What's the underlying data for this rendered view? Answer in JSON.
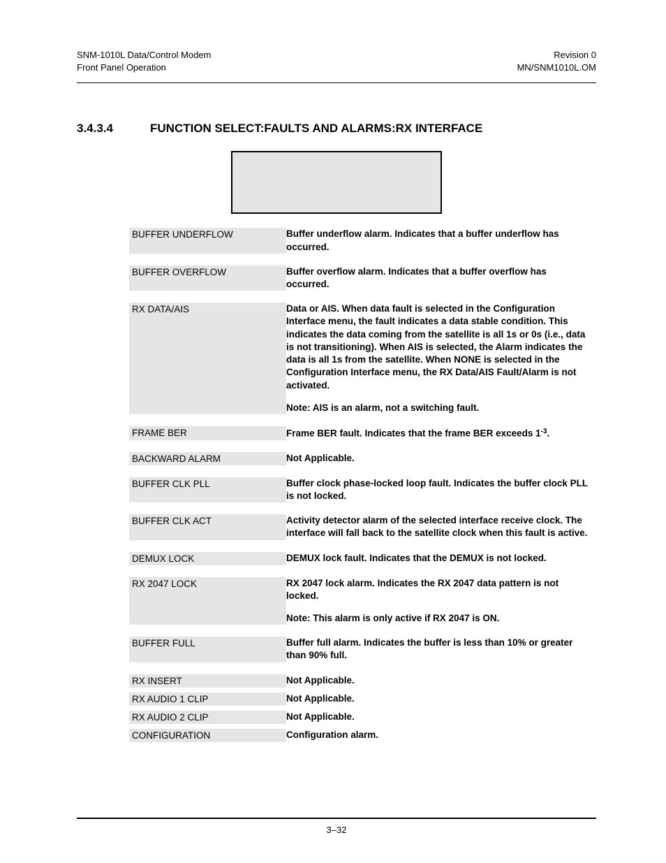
{
  "header": {
    "left_line1": "SNM-1010L Data/Control Modem",
    "left_line2": "Front Panel Operation",
    "right_line1": "Revision 0",
    "right_line2": "MN/SNM1010L.OM"
  },
  "section": {
    "number": "3.4.3.4",
    "title": "FUNCTION SELECT:FAULTS AND ALARMS:RX INTERFACE"
  },
  "rows": [
    {
      "label": "BUFFER UNDERFLOW",
      "desc": "Buffer underflow alarm. Indicates that a buffer underflow has occurred."
    },
    {
      "label": "BUFFER OVERFLOW",
      "desc": "Buffer overflow alarm. Indicates that a buffer overflow has occurred."
    },
    {
      "label": "RX DATA/AIS",
      "desc": "Data or AIS. When data fault is selected in the Configuration Interface menu, the fault indicates a data stable condition. This indicates the data coming from the satellite is all 1s or 0s (i.e., data is not transitioning). When AIS is selected, the Alarm indicates the data is all 1s from the satellite. When NONE is selected in the Configuration Interface menu, the RX Data/AIS Fault/Alarm is not activated.",
      "note": "Note: AIS is an alarm, not a switching fault."
    },
    {
      "label": "FRAME BER",
      "desc_pre": "Frame BER fault. Indicates that the frame BER exceeds 1",
      "desc_sup": "-3",
      "desc_post": "."
    },
    {
      "label": "BACKWARD ALARM",
      "desc": "Not Applicable."
    },
    {
      "label": "BUFFER CLK PLL",
      "desc": "Buffer clock phase-locked loop fault. Indicates the buffer clock PLL is not locked."
    },
    {
      "label": "BUFFER CLK ACT",
      "desc": "Activity detector alarm of the selected interface receive clock. The interface will fall back to the satellite clock when this fault is active."
    },
    {
      "label": "DEMUX LOCK",
      "desc": "DEMUX lock fault. Indicates that the DEMUX is not locked."
    },
    {
      "label": "RX 2047 LOCK",
      "desc": "RX 2047 lock alarm. Indicates the RX 2047 data pattern is not locked.",
      "note": "Note: This alarm is only active if RX 2047 is ON."
    },
    {
      "label": "BUFFER FULL",
      "desc": "Buffer full alarm. Indicates the buffer is less than 10% or greater than 90% full."
    },
    {
      "label": "RX INSERT",
      "desc": "Not Applicable.",
      "tight": true
    },
    {
      "label": "RX AUDIO 1 CLIP",
      "desc": "Not Applicable.",
      "tight": true
    },
    {
      "label": "RX AUDIO 2 CLIP",
      "desc": "Not Applicable.",
      "tight": true
    },
    {
      "label": "CONFIGURATION",
      "desc": "Configuration alarm."
    }
  ],
  "footer": {
    "page": "3–32"
  }
}
